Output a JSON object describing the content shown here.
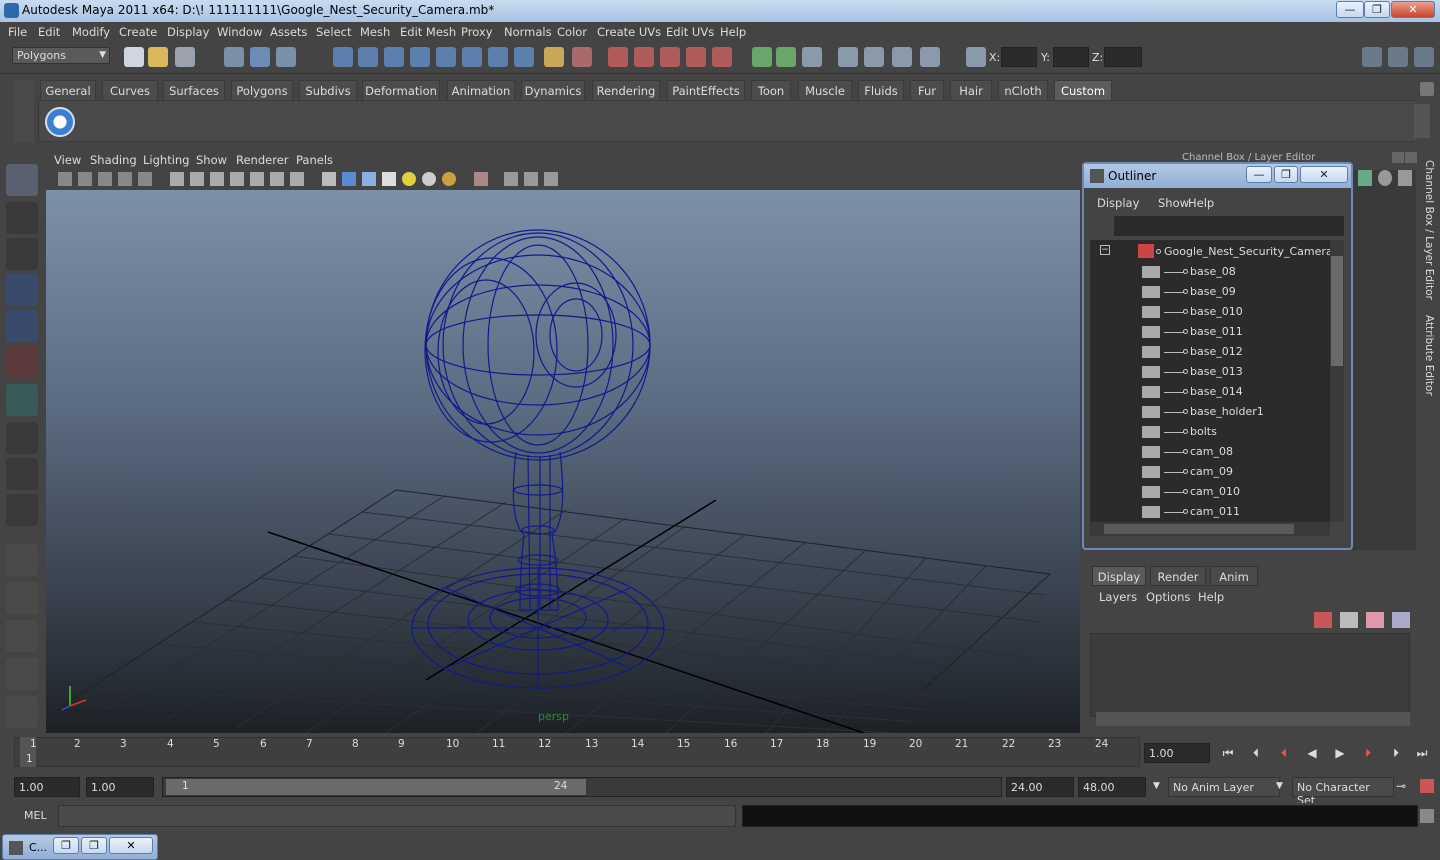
{
  "window": {
    "title": "Autodesk Maya 2011 x64: D:\\! 111111111\\Google_Nest_Security_Camera.mb*",
    "min": "—",
    "max": "❐",
    "close": "✕"
  },
  "menus": [
    "File",
    "Edit",
    "Modify",
    "Create",
    "Display",
    "Window",
    "Assets",
    "Select",
    "Mesh",
    "Edit Mesh",
    "Proxy",
    "Normals",
    "Color",
    "Create UVs",
    "Edit UVs",
    "Help"
  ],
  "status": {
    "mode": "Polygons",
    "x_label": "X:",
    "y_label": "Y:",
    "z_label": "Z:"
  },
  "shelf_tabs": [
    "General",
    "Curves",
    "Surfaces",
    "Polygons",
    "Subdivs",
    "Deformation",
    "Animation",
    "Dynamics",
    "Rendering",
    "PaintEffects",
    "Toon",
    "Muscle",
    "Fluids",
    "Fur",
    "Hair",
    "nCloth",
    "Custom"
  ],
  "shelf_active": "Custom",
  "panel_menus": [
    "View",
    "Shading",
    "Lighting",
    "Show",
    "Renderer",
    "Panels"
  ],
  "viewport": {
    "camera_label": "persp"
  },
  "channelbox_title": "Channel Box / Layer Editor",
  "side_tabs": {
    "channel": "Channel Box / Layer Editor",
    "attr": "Attribute Editor"
  },
  "outliner": {
    "title": "Outliner",
    "menus": [
      "Display",
      "Show",
      "Help"
    ],
    "root": "Google_Nest_Security_Camera",
    "items": [
      "base_08",
      "base_09",
      "base_010",
      "base_011",
      "base_012",
      "base_013",
      "base_014",
      "base_holder1",
      "bolts",
      "cam_08",
      "cam_09",
      "cam_010",
      "cam_011"
    ]
  },
  "layer_editor": {
    "tabs": [
      "Display",
      "Render",
      "Anim"
    ],
    "active": "Display",
    "menus": [
      "Layers",
      "Options",
      "Help"
    ]
  },
  "timeline": {
    "ticks": [
      "1",
      "2",
      "3",
      "4",
      "5",
      "6",
      "7",
      "8",
      "9",
      "10",
      "11",
      "12",
      "13",
      "14",
      "15",
      "16",
      "17",
      "18",
      "19",
      "20",
      "21",
      "22",
      "23",
      "24"
    ],
    "current_frame": "1",
    "current_time": "1.00"
  },
  "range": {
    "start": "1.00",
    "playback_start": "1.00",
    "slider_start": "1",
    "slider_end": "24",
    "playback_end": "24.00",
    "end": "48.00",
    "anim_layer": "No Anim Layer",
    "char_set": "No Character Set"
  },
  "cmd": {
    "label": "MEL"
  },
  "taskbar": {
    "item": "C..."
  }
}
